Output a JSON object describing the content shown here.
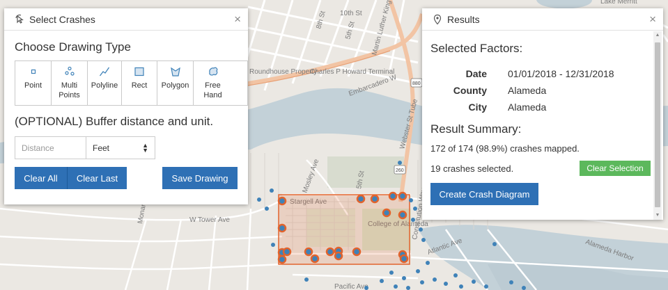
{
  "map": {
    "labels": {
      "street_10": "10th St",
      "street_5": "5th St",
      "street_8": "8th St",
      "street_mlk": "Martin Luther King Jr",
      "roundhouse": "Roundhouse Property",
      "charles": "Charles P Howard Terminal",
      "embarcadero": "Embarcadero W",
      "webster": "Webster St Tube",
      "lake": "Lake Merritt",
      "mosley": "Mosley Ave",
      "stargell": "Stargell Ave",
      "wtower": "W Tower Ave",
      "college": "College of Alameda",
      "constitution": "Constitution Way",
      "atlantic": "Atlantic Ave",
      "pacific": "Pacific Ave",
      "harbor": "Alameda Harbor",
      "monarch": "Monarch St",
      "street_5_b": "5th St",
      "route_880": "880",
      "route_260": "260"
    },
    "colors": {
      "water": "#c3d1d8",
      "land": "#ebe8e3",
      "road": "#ffffff",
      "highway": "#f2c4a4",
      "crash": "#3f82b8",
      "selection": "#e2632c"
    }
  },
  "select_panel": {
    "title": "Select Crashes",
    "header_icon": "cursor-icon",
    "section_title": "Choose Drawing Type",
    "tools": [
      {
        "line1": "Point",
        "line2": "",
        "icon": "point-icon"
      },
      {
        "line1": "Multi",
        "line2": "Points",
        "icon": "multipoint-icon"
      },
      {
        "line1": "Polyline",
        "line2": "",
        "icon": "polyline-icon"
      },
      {
        "line1": "Rect",
        "line2": "",
        "icon": "rect-icon"
      },
      {
        "line1": "Polygon",
        "line2": "",
        "icon": "polygon-icon"
      },
      {
        "line1": "Free",
        "line2": "Hand",
        "icon": "freehand-icon"
      }
    ],
    "buffer_title": "(OPTIONAL) Buffer distance and unit.",
    "distance_placeholder": "Distance",
    "unit_value": "Feet",
    "clear_all": "Clear All",
    "clear_last": "Clear Last",
    "save_drawing": "Save Drawing",
    "close": "×"
  },
  "results_panel": {
    "title": "Results",
    "header_icon": "map-pin-icon",
    "selected_factors_title": "Selected Factors:",
    "factors": [
      {
        "key": "Date",
        "value": "01/01/2018 - 12/31/2018"
      },
      {
        "key": "County",
        "value": "Alameda"
      },
      {
        "key": "City",
        "value": "Alameda"
      }
    ],
    "summary_title": "Result Summary:",
    "mapped_text": "172 of 174 (98.9%) crashes mapped.",
    "selected_text": "19 crashes selected.",
    "clear_selection": "Clear Selection",
    "create_diagram": "Create Crash Diagram",
    "close": "×"
  }
}
